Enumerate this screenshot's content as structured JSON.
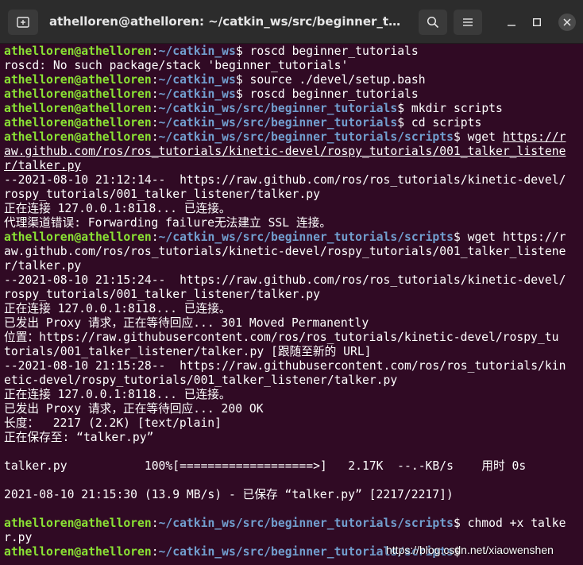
{
  "window": {
    "title": "athelloren@athelloren: ~/catkin_ws/src/beginner_tutorials/...",
    "colors": {
      "background": "#300a24",
      "titlebar": "#2c2c2c",
      "user": "#8ae234",
      "path": "#729fcf"
    }
  },
  "prompt": {
    "user": "athelloren@athelloren",
    "sep": ":",
    "path_ws": "~/catkin_ws",
    "path_pkg": "~/catkin_ws/src/beginner_tutorials",
    "path_scripts": "~/catkin_ws/src/beginner_tutorials/scripts",
    "symbol": "$ "
  },
  "terminal": {
    "cmd1": "roscd beginner_tutorials",
    "out1": "roscd: No such package/stack 'beginner_tutorials'",
    "cmd2": "source ./devel/setup.bash",
    "cmd3": "roscd beginner_tutorials",
    "cmd4": "mkdir scripts",
    "cmd5": "cd scripts",
    "cmd6_a": "wget ",
    "cmd6_url_a": "https://r",
    "cmd6_url_b": "aw.github.com/ros/ros_tutorials/kinetic-devel/rospy_tutorials/001_talker_listene",
    "cmd6_url_c": "r/talker.py",
    "w1_1": "--2021-08-10 21:12:14--  https://raw.github.com/ros/ros_tutorials/kinetic-devel/",
    "w1_2": "rospy_tutorials/001_talker_listener/talker.py",
    "w1_3": "正在连接 127.0.0.1:8118... 已连接。",
    "w1_4": "代理渠道错误: Forwarding failure无法建立 SSL 连接。",
    "cmd7_a": "wget https://r",
    "cmd7_b": "aw.github.com/ros/ros_tutorials/kinetic-devel/rospy_tutorials/001_talker_listene",
    "cmd7_c": "r/talker.py",
    "w2_1": "--2021-08-10 21:15:24--  https://raw.github.com/ros/ros_tutorials/kinetic-devel/",
    "w2_2": "rospy_tutorials/001_talker_listener/talker.py",
    "w2_3": "正在连接 127.0.0.1:8118... 已连接。",
    "w2_4": "已发出 Proxy 请求，正在等待回应... 301 Moved Permanently",
    "w2_5": "位置：https://raw.githubusercontent.com/ros/ros_tutorials/kinetic-devel/rospy_tu",
    "w2_6": "torials/001_talker_listener/talker.py [跟随至新的 URL]",
    "w3_1": "--2021-08-10 21:15:28--  https://raw.githubusercontent.com/ros/ros_tutorials/kin",
    "w3_2": "etic-devel/rospy_tutorials/001_talker_listener/talker.py",
    "w3_3": "正在连接 127.0.0.1:8118... 已连接。",
    "w3_4": "已发出 Proxy 请求，正在等待回应... 200 OK",
    "w3_5": "长度：  2217 (2.2K) [text/plain]",
    "w3_6": "正在保存至: “talker.py”",
    "progress": "talker.py           100%[===================>]   2.17K  --.-KB/s    用时 0s",
    "saved": "2021-08-10 21:15:30 (13.9 MB/s) - 已保存 “talker.py” [2217/2217])",
    "cmd8_a": "chmod +x talke",
    "cmd8_b": "r.py"
  },
  "watermark": "https://blog.csdn.net/xiaowenshen",
  "icons": {
    "new_tab": "new-tab-icon",
    "search": "search-icon",
    "menu": "hamburger-menu-icon",
    "minimize": "minimize-icon",
    "maximize": "maximize-icon",
    "close": "close-icon"
  }
}
